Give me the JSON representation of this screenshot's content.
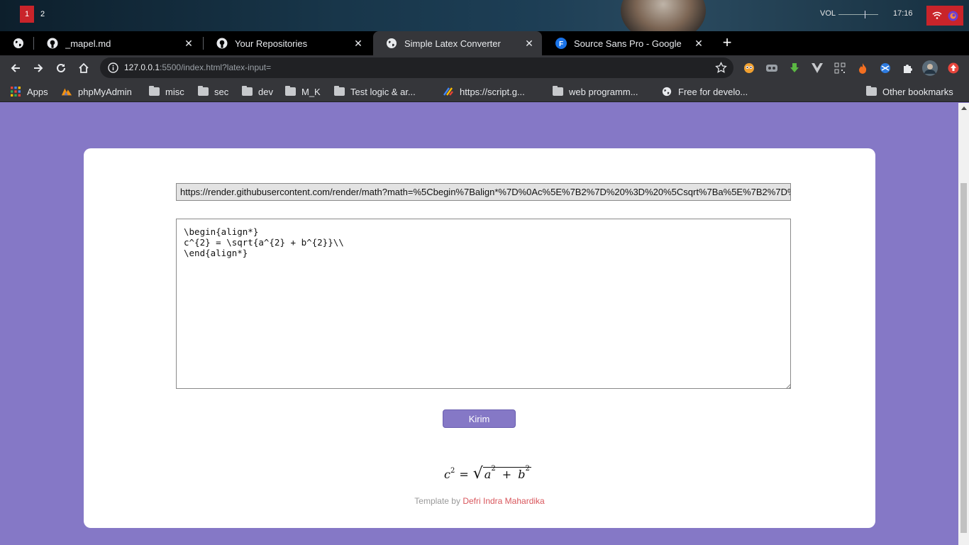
{
  "system_bar": {
    "workspaces": [
      "1",
      "2"
    ],
    "volume_label": "VOL",
    "volume_level": 0.66,
    "clock": "17:16",
    "tray_icons": [
      "wifi-icon",
      "firefox-icon"
    ]
  },
  "tabs": [
    {
      "icon": "globe-icon",
      "title": "",
      "active": false
    },
    {
      "icon": "github-icon",
      "title": "_mapel.md",
      "active": false
    },
    {
      "icon": "github-icon",
      "title": "Your Repositories",
      "active": false
    },
    {
      "icon": "globe-icon",
      "title": "Simple Latex Converter",
      "active": true
    },
    {
      "icon": "fonts-icon",
      "title": "Source Sans Pro - Google",
      "active": false
    }
  ],
  "toolbar": {
    "url_host": "127.0.0.1",
    "url_rest": ":5500/index.html?latex-input=",
    "extensions": [
      "extension-1-icon",
      "extension-2-icon",
      "download-icon",
      "vue-icon",
      "qr-icon",
      "fire-icon",
      "ball-icon",
      "puzzle-icon",
      "profile-avatar",
      "update-icon"
    ]
  },
  "bookmarks": {
    "items": [
      {
        "label": "Apps",
        "icon": "apps-grid-icon"
      },
      {
        "label": "phpMyAdmin",
        "icon": "phpmyadmin-icon"
      },
      {
        "label": "misc",
        "icon": "folder-icon"
      },
      {
        "label": "sec",
        "icon": "folder-icon"
      },
      {
        "label": "dev",
        "icon": "folder-icon"
      },
      {
        "label": "M_K",
        "icon": "folder-icon"
      },
      {
        "label": "Test logic & ar...",
        "icon": "folder-icon"
      },
      {
        "label": "https://script.g...",
        "icon": "script-icon"
      },
      {
        "label": "web programm...",
        "icon": "folder-icon"
      },
      {
        "label": "Free for develo...",
        "icon": "globe-icon"
      }
    ],
    "other": "Other bookmarks"
  },
  "page": {
    "render_url": "https://render.githubusercontent.com/render/math?math=%5Cbegin%7Balign*%7D%0Ac%5E%7B2%7D%20%3D%20%5Csqrt%7Ba%5E%7B2%7D%20%2B%20b%5E%7B2%",
    "latex_input": "\\begin{align*}\nc^{2} = \\sqrt{a^{2} + b^{2}}\\\\\n\\end{align*}",
    "submit_label": "Kirim",
    "formula": {
      "lhs_base": "c",
      "lhs_exp": "2",
      "eq": "=",
      "a": "a",
      "a_exp": "2",
      "plus": "+",
      "b": "b",
      "b_exp": "2"
    },
    "footer_prefix": "Template by ",
    "footer_author": "Defri Indra Mahardika"
  },
  "colors": {
    "background": "#8578c6",
    "card": "#ffffff",
    "button": "#8578c6",
    "author_link": "#d9575d"
  }
}
